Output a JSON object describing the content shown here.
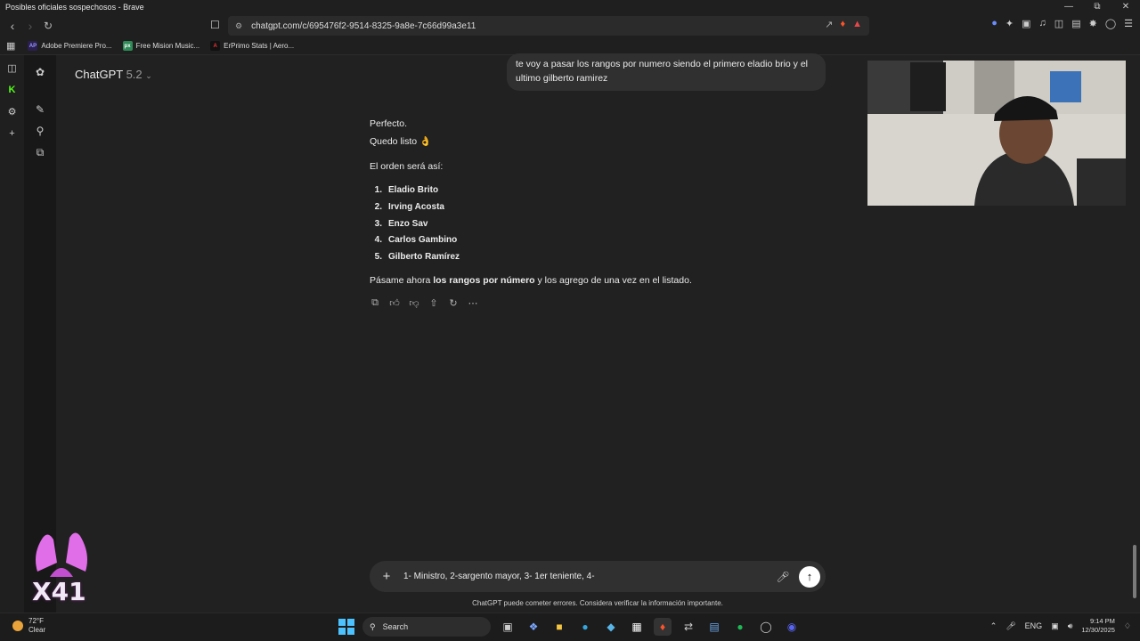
{
  "window": {
    "title": "Posibles oficiales sospechosos - Brave"
  },
  "browser": {
    "url": "chatgpt.com/c/695476f2-9514-8325-9a8e-7c66d99a3e11",
    "bookmarks": [
      {
        "label": "Adobe Premiere Pro...",
        "icon": "AP",
        "color": "#9999ff"
      },
      {
        "label": "Free Mision Music...",
        "icon": "px",
        "color": "#2e8b57"
      },
      {
        "label": "ErPrimo Stats | Aero...",
        "icon": "A",
        "color": "#111111"
      }
    ]
  },
  "app": {
    "model": "ChatGPT",
    "version": "5.2"
  },
  "conversation": {
    "user_message": "te voy a pasar los rangos por numero siendo el primero eladio brio y el ultimo gilberto ramirez",
    "assistant": {
      "line1": "Perfecto.",
      "line2": "Quedo listo",
      "line2_emoji": "👌",
      "intro": "El orden será así:",
      "list": [
        {
          "num": "1.",
          "name": "Eladio Brito"
        },
        {
          "num": "2.",
          "name": "Irving Acosta"
        },
        {
          "num": "3.",
          "name": "Enzo Sav"
        },
        {
          "num": "4.",
          "name": "Carlos Gambino"
        },
        {
          "num": "5.",
          "name": "Gilberto Ramírez"
        }
      ],
      "closing_pre": "Pásame ahora ",
      "closing_bold": "los rangos por número",
      "closing_post": " y los agrego de una vez en el listado."
    }
  },
  "composer": {
    "value": "1- Ministro, 2-sargento mayor, 3- 1er teniente, 4-"
  },
  "disclaimer": "ChatGPT puede cometer errores. Considera verificar la información importante.",
  "overlay": {
    "sticker_text": "X41"
  },
  "taskbar": {
    "weather_temp": "72°F",
    "weather_desc": "Clear",
    "search_label": "Search",
    "language": "ENG",
    "time": "9:14 PM",
    "date": "12/30/2025"
  }
}
